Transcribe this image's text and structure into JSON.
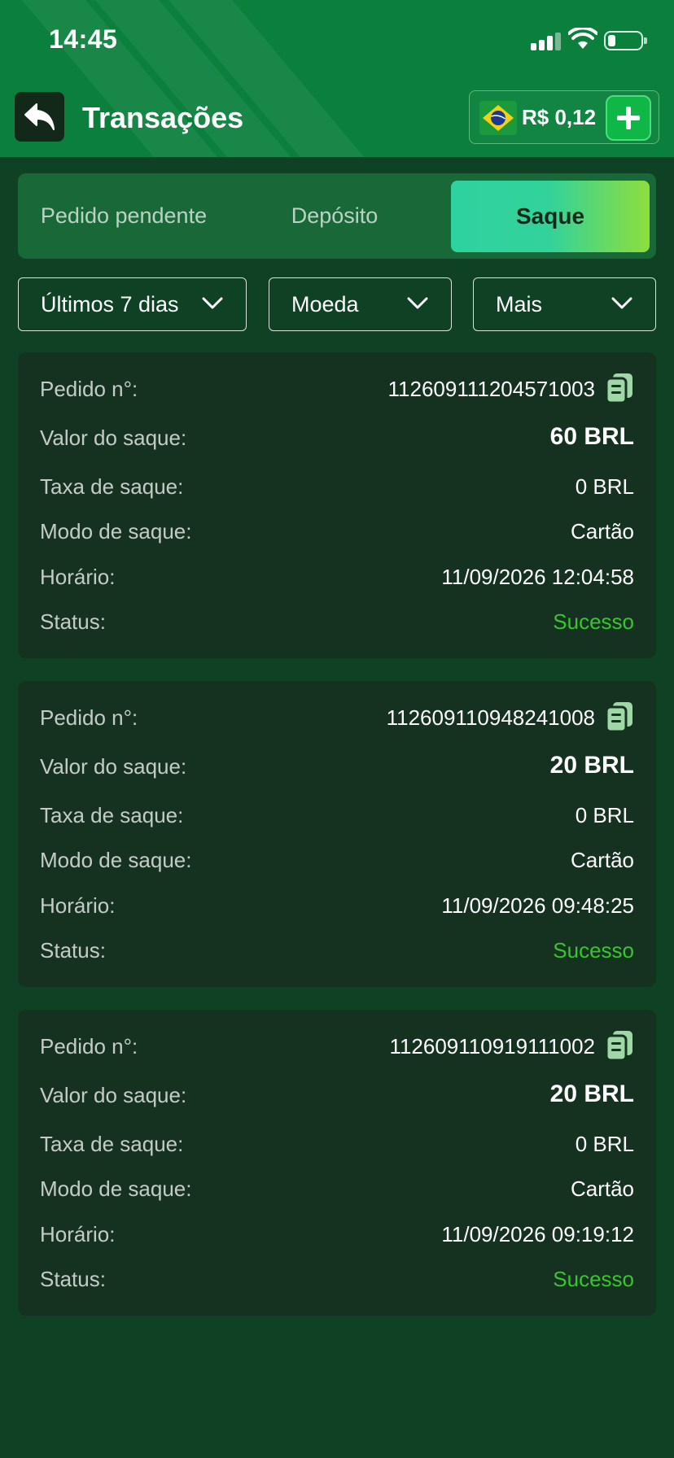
{
  "status_bar": {
    "time": "14:45"
  },
  "header": {
    "title": "Transações",
    "balance": "R$ 0,12"
  },
  "tabs": [
    {
      "label": "Pedido pendente",
      "active": false
    },
    {
      "label": "Depósito",
      "active": false
    },
    {
      "label": "Saque",
      "active": true
    }
  ],
  "filters": {
    "period": "Últimos 7 dias",
    "currency": "Moeda",
    "more": "Mais"
  },
  "labels": {
    "order": "Pedido n°:",
    "amount": "Valor do saque:",
    "fee": "Taxa de saque:",
    "mode": "Modo de saque:",
    "time": "Horário:",
    "status": "Status:"
  },
  "transactions": [
    {
      "order": "112609111204571003",
      "amount": "60 BRL",
      "fee": "0 BRL",
      "mode": "Cartão",
      "time": "11/09/2026 12:04:58",
      "status": "Sucesso"
    },
    {
      "order": "112609110948241008",
      "amount": "20 BRL",
      "fee": "0 BRL",
      "mode": "Cartão",
      "time": "11/09/2026 09:48:25",
      "status": "Sucesso"
    },
    {
      "order": "112609110919111002",
      "amount": "20 BRL",
      "fee": "0 BRL",
      "mode": "Cartão",
      "time": "11/09/2026 09:19:12",
      "status": "Sucesso"
    }
  ],
  "colors": {
    "header_bg": "#0a803c",
    "page_bg": "#0f4124",
    "card_bg": "#14321f",
    "success": "#3ac432",
    "accent_start": "#2ed29f",
    "accent_end": "#8ede3c"
  },
  "icons": {
    "back": "back-arrow-icon",
    "add": "plus-icon",
    "flag": "brazil-flag-icon",
    "copy": "copy-icon",
    "chevron": "chevron-down-icon"
  }
}
